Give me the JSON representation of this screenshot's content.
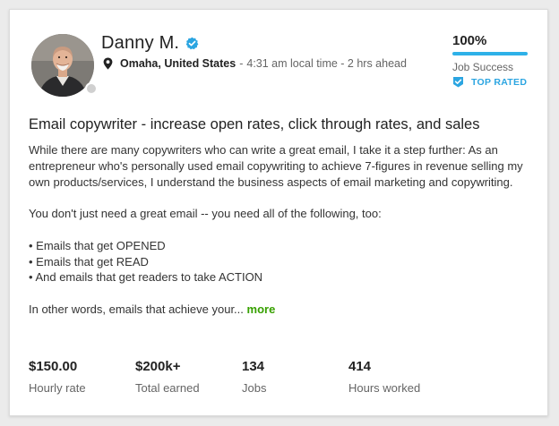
{
  "profile": {
    "name": "Danny M.",
    "location": "Omaha, United States",
    "separator": "-",
    "local_time": "4:31 am local time - 2 hrs ahead",
    "verified_icon": "verified-check-icon",
    "location_icon": "map-pin-icon",
    "avatar": "profile-photo",
    "status": "offline"
  },
  "job_success": {
    "value": "100%",
    "percent": 100,
    "label": "Job Success"
  },
  "badge": {
    "label": "TOP RATED",
    "icon": "top-rated-badge-icon"
  },
  "overview": {
    "title": "Email copywriter - increase open rates, click through rates, and sales",
    "paragraph1": "While there are many copywriters who can write a great email, I take it a step further: As an entrepreneur who's personally used email copywriting to achieve 7-figures in revenue selling my own products/services, I understand the business aspects of email marketing and copywriting.",
    "paragraph2": "You don't just need a great email -- you need all of the following, too:",
    "bullets": [
      "• Emails that get OPENED",
      "• Emails that get READ",
      "• And emails that get readers to take ACTION"
    ],
    "teaser": "In other words, emails that achieve your...",
    "more_label": "more"
  },
  "stats": [
    {
      "value": "$150.00",
      "label": "Hourly rate"
    },
    {
      "value": "$200k+",
      "label": "Total earned"
    },
    {
      "value": "134",
      "label": "Jobs"
    },
    {
      "value": "414",
      "label": "Hours worked"
    }
  ],
  "colors": {
    "accent_blue": "#2eb1e8",
    "badge_blue": "#2ba5e1",
    "more_green": "#37a000",
    "text_dark": "#222222",
    "text_muted": "#656565"
  }
}
